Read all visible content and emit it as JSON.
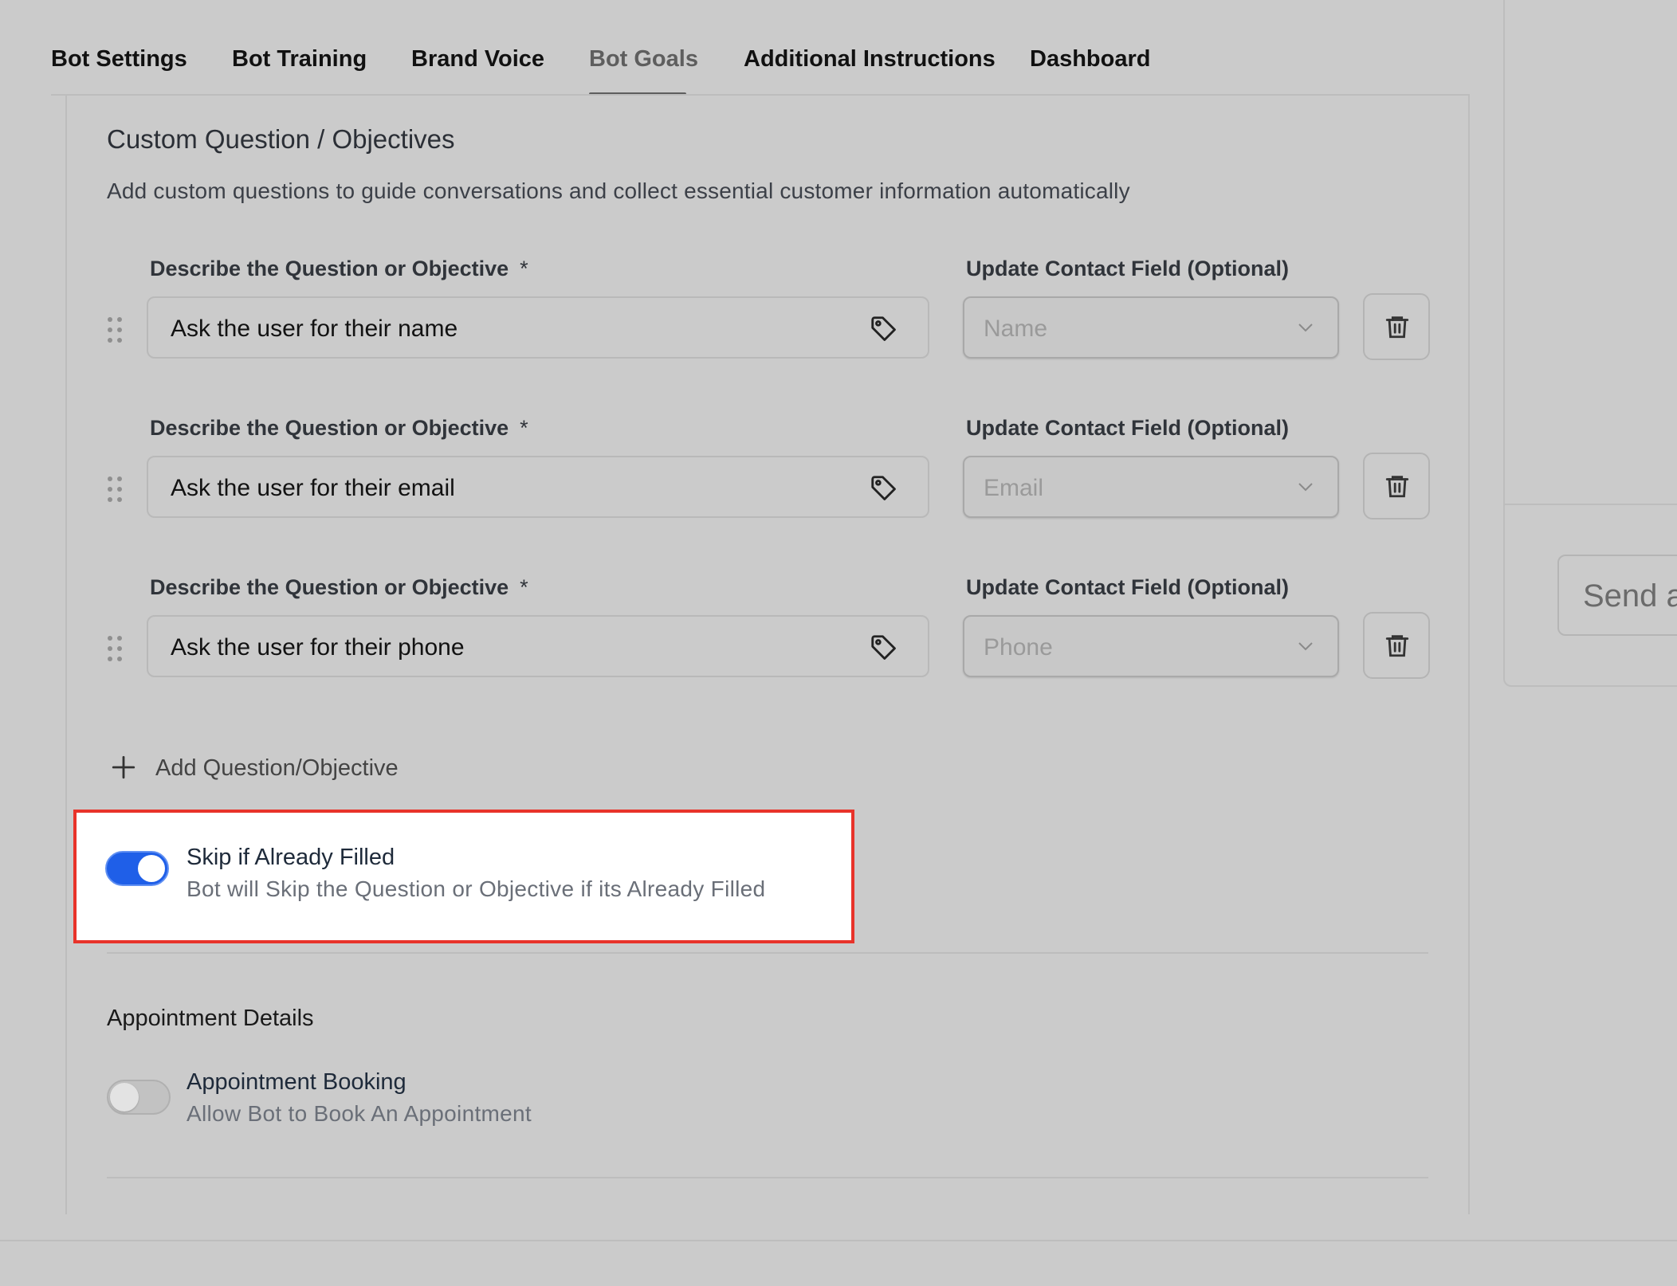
{
  "tabs": [
    {
      "label": "Bot Settings"
    },
    {
      "label": "Bot Training"
    },
    {
      "label": "Brand Voice"
    },
    {
      "label": "Bot Goals"
    },
    {
      "label": "Additional Instructions"
    },
    {
      "label": "Dashboard"
    }
  ],
  "active_tab": "Bot Goals",
  "section": {
    "title": "Custom Question / Objectives",
    "description": "Add custom questions to guide conversations and collect essential customer information automatically"
  },
  "questions": [
    {
      "label": "Describe the Question or Objective",
      "required": "*",
      "value": "Ask the user for their name",
      "field_label": "Update Contact Field (Optional)",
      "field_value": "Name"
    },
    {
      "label": "Describe the Question or Objective",
      "required": "*",
      "value": "Ask the user for their email",
      "field_label": "Update Contact Field (Optional)",
      "field_value": "Email"
    },
    {
      "label": "Describe the Question or Objective",
      "required": "*",
      "value": "Ask the user for their phone",
      "field_label": "Update Contact Field (Optional)",
      "field_value": "Phone"
    }
  ],
  "add_button": "Add Question/Objective",
  "skip_option": {
    "title": "Skip if Already Filled",
    "description": "Bot will Skip the Question or Objective if its Already Filled",
    "enabled": true
  },
  "appointment": {
    "section_title": "Appointment Details",
    "title": "Appointment Booking",
    "description": "Allow Bot to Book An Appointment",
    "enabled": false
  },
  "preview": {
    "input_placeholder": "Send a"
  },
  "colors": {
    "toggle_on": "#1f5fe8",
    "highlight_border": "#e8332a",
    "background": "#cbcbcb"
  },
  "icons": [
    "tag-icon",
    "chevron-down-icon",
    "trash-icon",
    "drag-handle-icon",
    "plus-icon"
  ]
}
